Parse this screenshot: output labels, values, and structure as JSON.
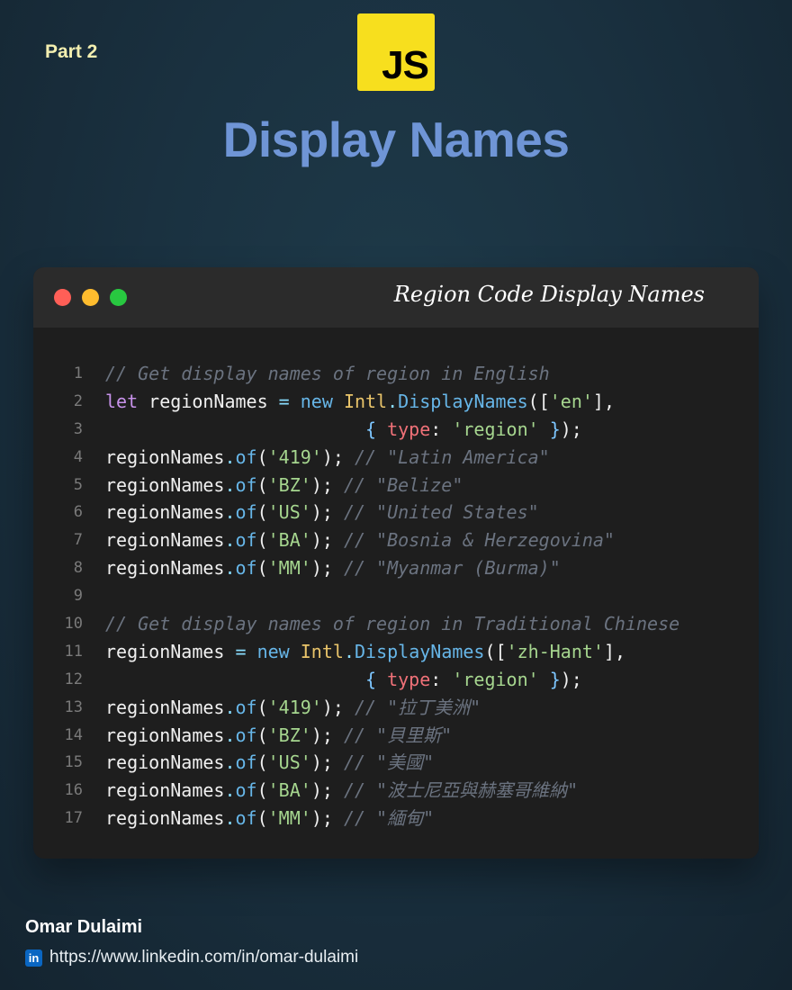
{
  "header": {
    "part_label": "Part 2",
    "logo_text": "JS",
    "title": "Display Names"
  },
  "window": {
    "title": "Region Code Display Names",
    "code_lines": [
      [
        {
          "t": "// Get display names of region in English",
          "c": "c"
        }
      ],
      [
        {
          "t": "let",
          "c": "k"
        },
        {
          "t": " regionNames "
        },
        {
          "t": "=",
          "c": "o"
        },
        {
          "t": " "
        },
        {
          "t": "new",
          "c": "n"
        },
        {
          "t": " "
        },
        {
          "t": "Intl",
          "c": "cl"
        },
        {
          "t": ".",
          "c": "o"
        },
        {
          "t": "DisplayNames",
          "c": "n"
        },
        {
          "t": "(["
        },
        {
          "t": "'en'",
          "c": "s"
        },
        {
          "t": "],"
        }
      ],
      [
        {
          "t": "                        "
        },
        {
          "t": "{",
          "c": "p"
        },
        {
          "t": " "
        },
        {
          "t": "type",
          "c": "pr"
        },
        {
          "t": ": "
        },
        {
          "t": "'region'",
          "c": "s"
        },
        {
          "t": " "
        },
        {
          "t": "}",
          "c": "p"
        },
        {
          "t": ");"
        }
      ],
      [
        {
          "t": "regionNames"
        },
        {
          "t": ".",
          "c": "o"
        },
        {
          "t": "of",
          "c": "n"
        },
        {
          "t": "("
        },
        {
          "t": "'419'",
          "c": "s"
        },
        {
          "t": "); "
        },
        {
          "t": "// \"Latin America\"",
          "c": "c"
        }
      ],
      [
        {
          "t": "regionNames"
        },
        {
          "t": ".",
          "c": "o"
        },
        {
          "t": "of",
          "c": "n"
        },
        {
          "t": "("
        },
        {
          "t": "'BZ'",
          "c": "s"
        },
        {
          "t": "); "
        },
        {
          "t": "// \"Belize\"",
          "c": "c"
        }
      ],
      [
        {
          "t": "regionNames"
        },
        {
          "t": ".",
          "c": "o"
        },
        {
          "t": "of",
          "c": "n"
        },
        {
          "t": "("
        },
        {
          "t": "'US'",
          "c": "s"
        },
        {
          "t": "); "
        },
        {
          "t": "// \"United States\"",
          "c": "c"
        }
      ],
      [
        {
          "t": "regionNames"
        },
        {
          "t": ".",
          "c": "o"
        },
        {
          "t": "of",
          "c": "n"
        },
        {
          "t": "("
        },
        {
          "t": "'BA'",
          "c": "s"
        },
        {
          "t": "); "
        },
        {
          "t": "// \"Bosnia & Herzegovina\"",
          "c": "c"
        }
      ],
      [
        {
          "t": "regionNames"
        },
        {
          "t": ".",
          "c": "o"
        },
        {
          "t": "of",
          "c": "n"
        },
        {
          "t": "("
        },
        {
          "t": "'MM'",
          "c": "s"
        },
        {
          "t": "); "
        },
        {
          "t": "// \"Myanmar (Burma)\"",
          "c": "c"
        }
      ],
      [],
      [
        {
          "t": "// Get display names of region in Traditional Chinese",
          "c": "c"
        }
      ],
      [
        {
          "t": "regionNames "
        },
        {
          "t": "=",
          "c": "o"
        },
        {
          "t": " "
        },
        {
          "t": "new",
          "c": "n"
        },
        {
          "t": " "
        },
        {
          "t": "Intl",
          "c": "cl"
        },
        {
          "t": ".",
          "c": "o"
        },
        {
          "t": "DisplayNames",
          "c": "n"
        },
        {
          "t": "(["
        },
        {
          "t": "'zh-Hant'",
          "c": "s"
        },
        {
          "t": "],"
        }
      ],
      [
        {
          "t": "                        "
        },
        {
          "t": "{",
          "c": "p"
        },
        {
          "t": " "
        },
        {
          "t": "type",
          "c": "pr"
        },
        {
          "t": ": "
        },
        {
          "t": "'region'",
          "c": "s"
        },
        {
          "t": " "
        },
        {
          "t": "}",
          "c": "p"
        },
        {
          "t": ");"
        }
      ],
      [
        {
          "t": "regionNames"
        },
        {
          "t": ".",
          "c": "o"
        },
        {
          "t": "of",
          "c": "n"
        },
        {
          "t": "("
        },
        {
          "t": "'419'",
          "c": "s"
        },
        {
          "t": "); "
        },
        {
          "t": "// \"拉丁美洲\"",
          "c": "c"
        }
      ],
      [
        {
          "t": "regionNames"
        },
        {
          "t": ".",
          "c": "o"
        },
        {
          "t": "of",
          "c": "n"
        },
        {
          "t": "("
        },
        {
          "t": "'BZ'",
          "c": "s"
        },
        {
          "t": "); "
        },
        {
          "t": "// \"貝里斯\"",
          "c": "c"
        }
      ],
      [
        {
          "t": "regionNames"
        },
        {
          "t": ".",
          "c": "o"
        },
        {
          "t": "of",
          "c": "n"
        },
        {
          "t": "("
        },
        {
          "t": "'US'",
          "c": "s"
        },
        {
          "t": "); "
        },
        {
          "t": "// \"美國\"",
          "c": "c"
        }
      ],
      [
        {
          "t": "regionNames"
        },
        {
          "t": ".",
          "c": "o"
        },
        {
          "t": "of",
          "c": "n"
        },
        {
          "t": "("
        },
        {
          "t": "'BA'",
          "c": "s"
        },
        {
          "t": "); "
        },
        {
          "t": "// \"波士尼亞與赫塞哥維納\"",
          "c": "c"
        }
      ],
      [
        {
          "t": "regionNames"
        },
        {
          "t": ".",
          "c": "o"
        },
        {
          "t": "of",
          "c": "n"
        },
        {
          "t": "("
        },
        {
          "t": "'MM'",
          "c": "s"
        },
        {
          "t": "); "
        },
        {
          "t": "// \"緬甸\"",
          "c": "c"
        }
      ]
    ]
  },
  "footer": {
    "author": "Omar Dulaimi",
    "linkedin_icon_text": "in",
    "url": "https://www.linkedin.com/in/omar-dulaimi"
  },
  "colors": {
    "title_blue": "#6f95d6",
    "js_yellow": "#f7df1e",
    "part_label": "#f3efb0",
    "editor_bg": "#1e1e1e",
    "titlebar_bg": "#2b2b2b",
    "linkedin_blue": "#0a66c2"
  }
}
